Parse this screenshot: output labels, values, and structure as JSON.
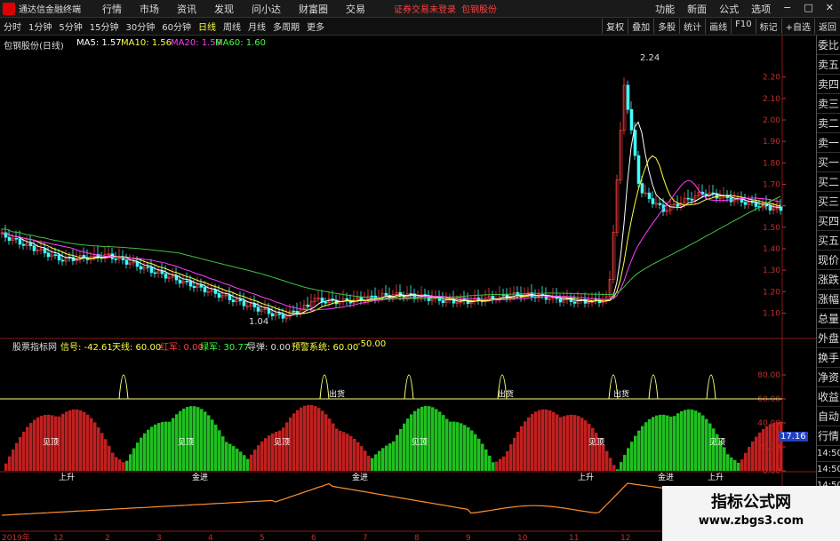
{
  "menubar": {
    "app_title": "通达信金融终端",
    "items": [
      "行情",
      "市场",
      "资讯",
      "发现",
      "问小达",
      "财富圈",
      "交易"
    ],
    "notice": "证券交易未登录",
    "stock_name": "包钢股份",
    "right_items": [
      "功能",
      "新面",
      "公式",
      "选项"
    ],
    "window_buttons": [
      "−",
      "□",
      "✕"
    ]
  },
  "toolbar": {
    "items": [
      "分时",
      "1分钟",
      "5分钟",
      "15分钟",
      "30分钟",
      "60分钟",
      "日线",
      "周线",
      "月线",
      "多周期",
      "更多"
    ],
    "active": "日线",
    "right_items": [
      "复权",
      "叠加",
      "多股",
      "统计",
      "画线",
      "F10",
      "标记",
      "+自选",
      "返回"
    ]
  },
  "main_panel": {
    "title": "包钢股份(日线)",
    "ma5": "MA5: 1.57",
    "ma10": "MA10: 1.56",
    "ma20": "MA20: 1.59",
    "ma60": "MA60: 1.60",
    "high_label": "2.24",
    "low_label": "1.04",
    "y_ticks": [
      "2.20",
      "2.10",
      "2.00",
      "1.90",
      "1.80",
      "1.70",
      "1.60",
      "1.50",
      "1.40",
      "1.30",
      "1.20",
      "1.10"
    ]
  },
  "indicator_panel": {
    "title": "股票指标网",
    "v1": "信号: -42.61",
    "v2": "天线: 60.00",
    "v3": "红军: 0.00",
    "v4": "绿军: 30.77",
    "v5": "导弹: 0.00",
    "v6": "预警系统: 60.00",
    "v7": "-50.00",
    "y_ticks": [
      "80.00",
      "60.00",
      "40.00",
      "20.00",
      "0.00"
    ],
    "current_value": "17.16",
    "annotations": {
      "chu_huo": "出货",
      "jian_ding": "见顶",
      "shang_sheng": "上升",
      "jin_jin": "金进"
    }
  },
  "x_axis": {
    "year": "2019年",
    "months": [
      "12",
      "2",
      "3",
      "4",
      "5",
      "6",
      "7",
      "8",
      "9",
      "10",
      "11",
      "12",
      "2",
      "3"
    ]
  },
  "sidepanel": {
    "items": [
      "委比",
      "卖五",
      "卖四",
      "卖三",
      "卖二",
      "卖一",
      "买一",
      "买二",
      "买三",
      "买四",
      "买五",
      "现价",
      "涨跌",
      "涨幅",
      "总量",
      "外盘",
      "换手",
      "净资",
      "收益",
      "自动",
      "行情",
      "14:50",
      "14:50",
      "14:50",
      "14:50",
      "14:50",
      "14:50",
      "14:50"
    ]
  },
  "watermark": {
    "line1": "指标公式网",
    "line2": "www.zbgs3.com"
  }
}
